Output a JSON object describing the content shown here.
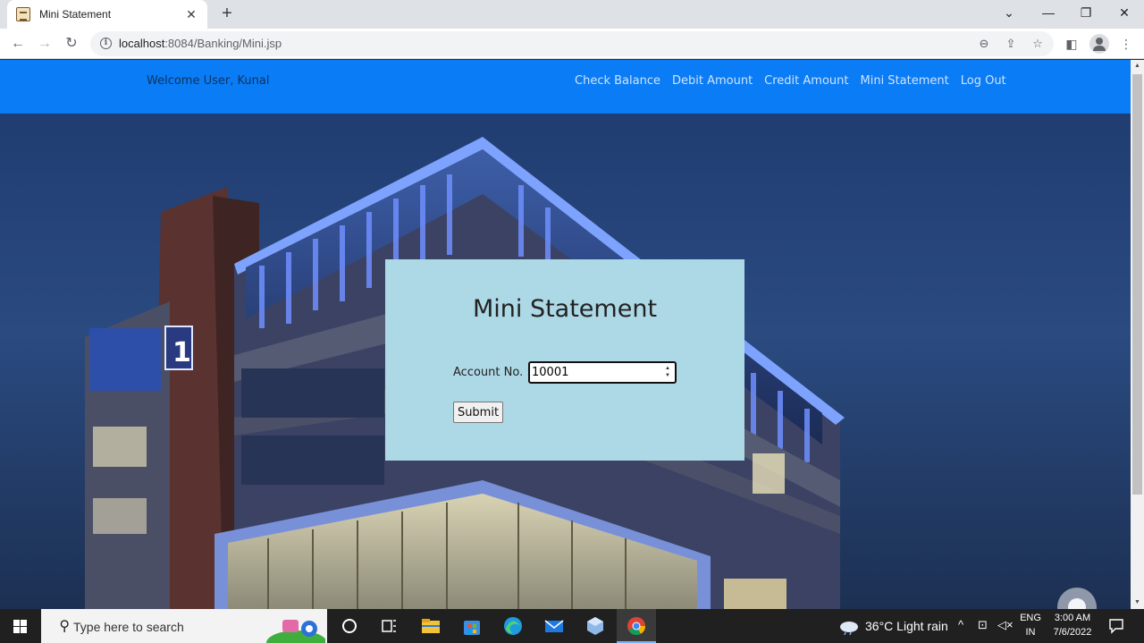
{
  "browser": {
    "tab_title": "Mini Statement",
    "tab_close": "✕",
    "new_tab": "+",
    "url_host": "localhost",
    "url_path": ":8084/Banking/Mini.jsp"
  },
  "navbar": {
    "welcome": "Welcome User, Kunal",
    "links": [
      "Check Balance",
      "Debit Amount",
      "Credit Amount",
      "Mini Statement",
      "Log Out"
    ]
  },
  "form": {
    "title": "Mini Statement",
    "account_label": "Account No. :",
    "account_value": "10001",
    "submit_label": "Submit"
  },
  "taskbar": {
    "search_placeholder": "Type here to search",
    "weather": "36°C  Light rain",
    "lang_top": "ENG",
    "lang_bottom": "IN",
    "time": "3:00 AM",
    "date": "7/6/2022"
  },
  "colors": {
    "navbar": "#0a7cf5",
    "panel": "#add8e6"
  },
  "icons": [
    "back-arrow-icon",
    "forward-arrow-icon",
    "reload-icon",
    "info-icon",
    "zoom-icon",
    "share-icon",
    "star-icon",
    "sidepanel-icon",
    "profile-icon",
    "menu-icon",
    "windows-icon",
    "search-icon",
    "cortana-icon",
    "task-view-icon",
    "file-explorer-icon",
    "store-icon",
    "edge-icon",
    "mail-icon",
    "app-icon",
    "chrome-icon",
    "weather-icon",
    "notification-icon"
  ]
}
